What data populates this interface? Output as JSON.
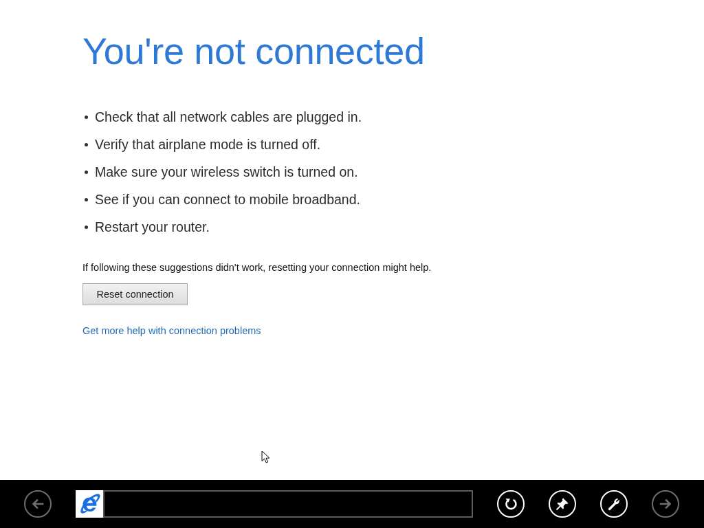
{
  "page": {
    "title": "You're not connected",
    "suggestions": [
      "Check that all network cables are plugged in.",
      "Verify that airplane mode is turned off.",
      "Make sure your wireless switch is turned on.",
      "See if you can connect to mobile broadband.",
      "Restart your router."
    ],
    "note": "If following these suggestions didn't work, resetting your connection might help.",
    "reset_button": "Reset connection",
    "help_link": "Get more help with connection problems"
  },
  "app_bar": {
    "left_buttons": [
      {
        "kind": "back",
        "disabled": true
      }
    ],
    "right_buttons": [
      {
        "kind": "refresh",
        "disabled": false
      },
      {
        "kind": "pin",
        "disabled": false
      },
      {
        "kind": "tools",
        "disabled": false
      },
      {
        "kind": "forward",
        "disabled": true
      }
    ]
  }
}
